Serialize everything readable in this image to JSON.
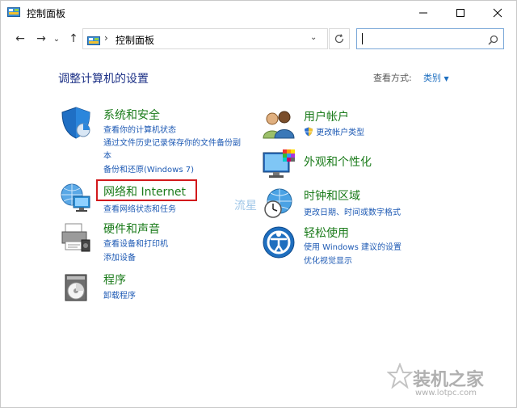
{
  "window": {
    "title": "控制面板"
  },
  "nav": {
    "back": "←",
    "forward": "→",
    "recent": "⌄",
    "up": "↑"
  },
  "address": {
    "separator": "›",
    "path": "控制面板",
    "dropdown": "⌄"
  },
  "search": {
    "placeholder": ""
  },
  "main": {
    "heading": "调整计算机的设置",
    "view_by_label": "查看方式:",
    "view_by_value": "类别",
    "categories": [
      {
        "title": "系统和安全",
        "links": [
          "查看你的计算机状态",
          "通过文件历史记录保存你的文件备份副",
          "本",
          "备份和还原(Windows 7)"
        ]
      },
      {
        "title": "网络和 Internet",
        "links": [
          "查看网络状态和任务"
        ]
      },
      {
        "title": "硬件和声音",
        "links": [
          "查看设备和打印机",
          "添加设备"
        ]
      },
      {
        "title": "程序",
        "links": [
          "卸载程序"
        ]
      },
      {
        "title": "用户帐户",
        "links": [
          "更改帐户类型"
        ]
      },
      {
        "title": "外观和个性化",
        "links": []
      },
      {
        "title": "时钟和区域",
        "links": [
          "更改日期、时间或数字格式"
        ]
      },
      {
        "title": "轻松使用",
        "links": [
          "使用 Windows 建议的设置",
          "优化视觉显示"
        ]
      }
    ]
  },
  "watermark": {
    "mid": "流星",
    "brand": "装机之家",
    "url": "www.lotpc.com"
  },
  "colors": {
    "heading": "#1e3287",
    "category_title": "#1a7b1a",
    "link": "#1e5ab4",
    "highlight_box": "#d2191c"
  }
}
